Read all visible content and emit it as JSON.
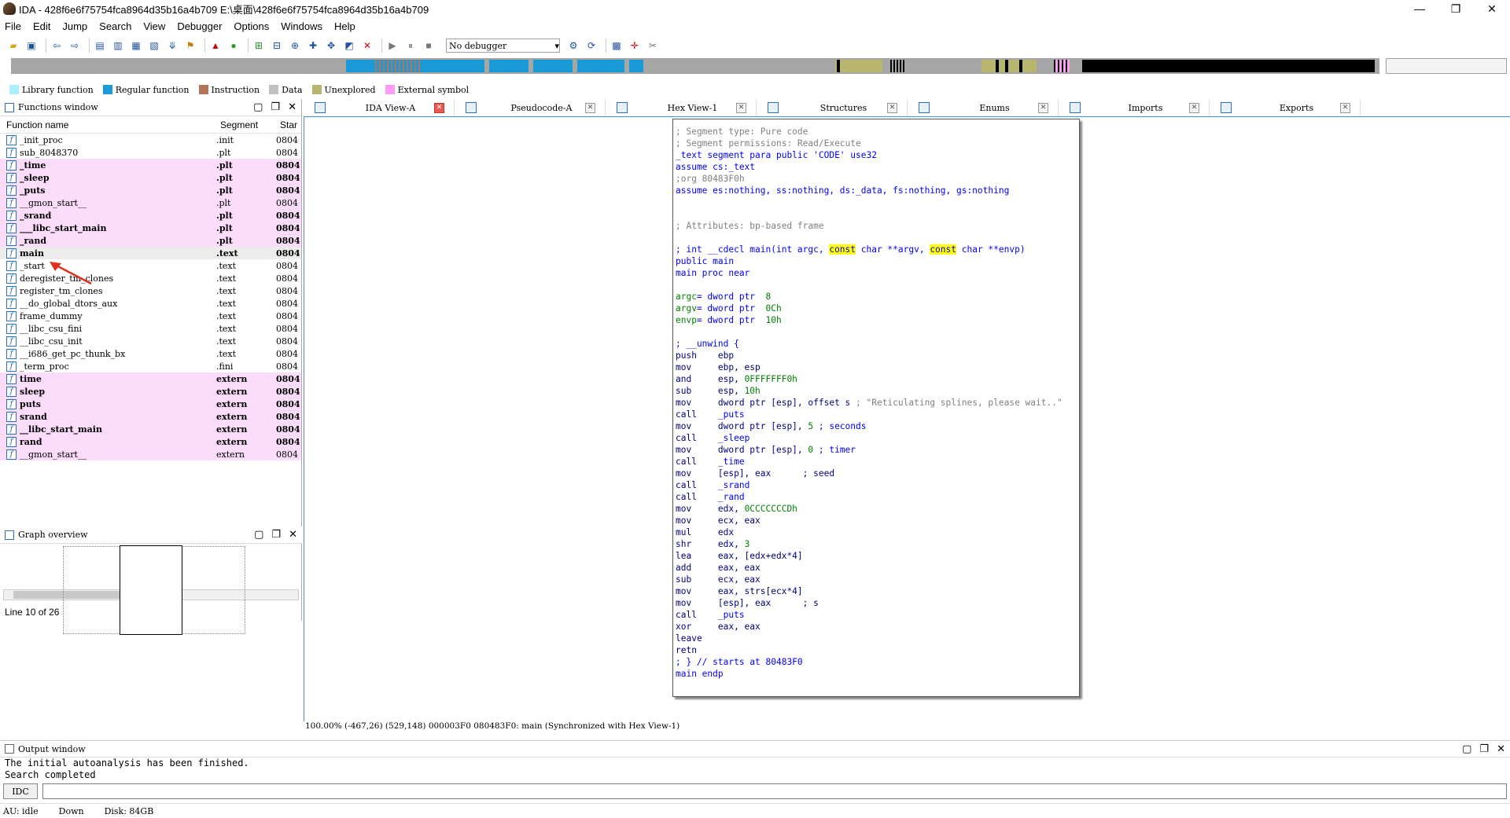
{
  "window": {
    "title": "IDA - 428f6e6f75754fca8964d35b16a4b709 E:\\桌面\\428f6e6f75754fca8964d35b16a4b709"
  },
  "menu": [
    "File",
    "Edit",
    "Jump",
    "Search",
    "View",
    "Debugger",
    "Options",
    "Windows",
    "Help"
  ],
  "toolbar": {
    "debugger": "No debugger"
  },
  "legend": [
    {
      "label": "Library function",
      "color": "#aeefff"
    },
    {
      "label": "Regular function",
      "color": "#1a9ad6"
    },
    {
      "label": "Instruction",
      "color": "#b5735a"
    },
    {
      "label": "Data",
      "color": "#c0c0c0"
    },
    {
      "label": "Unexplored",
      "color": "#b8b56e"
    },
    {
      "label": "External symbol",
      "color": "#ff9cf4"
    }
  ],
  "functions": {
    "title": "Functions window",
    "columns": [
      "Function name",
      "Segment",
      "Star"
    ],
    "rows": [
      {
        "name": "_init_proc",
        "segment": ".init",
        "start": "0804",
        "lib": false,
        "bold": false
      },
      {
        "name": "sub_8048370",
        "segment": ".plt",
        "start": "0804",
        "lib": false,
        "bold": false
      },
      {
        "name": "_time",
        "segment": ".plt",
        "start": "0804",
        "lib": true,
        "bold": true
      },
      {
        "name": "_sleep",
        "segment": ".plt",
        "start": "0804",
        "lib": true,
        "bold": true
      },
      {
        "name": "_puts",
        "segment": ".plt",
        "start": "0804",
        "lib": true,
        "bold": true
      },
      {
        "name": "__gmon_start__",
        "segment": ".plt",
        "start": "0804",
        "lib": true,
        "bold": false
      },
      {
        "name": "_srand",
        "segment": ".plt",
        "start": "0804",
        "lib": true,
        "bold": true
      },
      {
        "name": "___libc_start_main",
        "segment": ".plt",
        "start": "0804",
        "lib": true,
        "bold": true
      },
      {
        "name": "_rand",
        "segment": ".plt",
        "start": "0804",
        "lib": true,
        "bold": true
      },
      {
        "name": "main",
        "segment": ".text",
        "start": "0804",
        "lib": false,
        "bold": true
      },
      {
        "name": "_start",
        "segment": ".text",
        "start": "0804",
        "lib": false,
        "bold": false
      },
      {
        "name": "deregister_tm_clones",
        "segment": ".text",
        "start": "0804",
        "lib": false,
        "bold": false
      },
      {
        "name": "register_tm_clones",
        "segment": ".text",
        "start": "0804",
        "lib": false,
        "bold": false
      },
      {
        "name": "__do_global_dtors_aux",
        "segment": ".text",
        "start": "0804",
        "lib": false,
        "bold": false
      },
      {
        "name": "frame_dummy",
        "segment": ".text",
        "start": "0804",
        "lib": false,
        "bold": false
      },
      {
        "name": "__libc_csu_fini",
        "segment": ".text",
        "start": "0804",
        "lib": false,
        "bold": false
      },
      {
        "name": "__libc_csu_init",
        "segment": ".text",
        "start": "0804",
        "lib": false,
        "bold": false
      },
      {
        "name": "__i686_get_pc_thunk_bx",
        "segment": ".text",
        "start": "0804",
        "lib": false,
        "bold": false
      },
      {
        "name": "_term_proc",
        "segment": ".fini",
        "start": "0804",
        "lib": false,
        "bold": false
      },
      {
        "name": "time",
        "segment": "extern",
        "start": "0804",
        "lib": true,
        "bold": true
      },
      {
        "name": "sleep",
        "segment": "extern",
        "start": "0804",
        "lib": true,
        "bold": true
      },
      {
        "name": "puts",
        "segment": "extern",
        "start": "0804",
        "lib": true,
        "bold": true
      },
      {
        "name": "srand",
        "segment": "extern",
        "start": "0804",
        "lib": true,
        "bold": true
      },
      {
        "name": "__libc_start_main",
        "segment": "extern",
        "start": "0804",
        "lib": true,
        "bold": true
      },
      {
        "name": "rand",
        "segment": "extern",
        "start": "0804",
        "lib": true,
        "bold": true
      },
      {
        "name": "__gmon_start__",
        "segment": "extern",
        "start": "0804",
        "lib": true,
        "bold": false
      }
    ],
    "line_info": "Line 10 of 26"
  },
  "graph_overview": {
    "title": "Graph overview"
  },
  "tabs": [
    {
      "label": "IDA View-A",
      "active": true
    },
    {
      "label": "Pseudocode-A",
      "active": false
    },
    {
      "label": "Hex View-1",
      "active": false
    },
    {
      "label": "Structures",
      "active": false
    },
    {
      "label": "Enums",
      "active": false
    },
    {
      "label": "Imports",
      "active": false
    },
    {
      "label": "Exports",
      "active": false
    }
  ],
  "code": [
    [
      {
        "t": "; Segment type: Pure code",
        "c": "c-gray"
      }
    ],
    [
      {
        "t": "; Segment permissions: Read/Execute",
        "c": "c-gray"
      }
    ],
    [
      {
        "t": "_text segment para public 'CODE' use32",
        "c": "c-blue"
      }
    ],
    [
      {
        "t": "assume cs:_text",
        "c": "c-blue"
      }
    ],
    [
      {
        "t": ";org 80483F0h",
        "c": "c-gray"
      }
    ],
    [
      {
        "t": "assume es:nothing, ss:nothing, ds:_data, fs:nothing, gs:nothing",
        "c": "c-blue"
      }
    ],
    [],
    [],
    [
      {
        "t": "; Attributes: bp-based frame",
        "c": "c-gray"
      }
    ],
    [],
    [
      {
        "t": "; int __cdecl main(int argc, ",
        "c": "c-blue"
      },
      {
        "t": "const",
        "c": "c-blue hl"
      },
      {
        "t": " char **argv, ",
        "c": "c-blue"
      },
      {
        "t": "const",
        "c": "c-blue hl"
      },
      {
        "t": " char **envp)",
        "c": "c-blue"
      }
    ],
    [
      {
        "t": "public main",
        "c": "c-blue"
      }
    ],
    [
      {
        "t": "main proc near",
        "c": "c-blue"
      }
    ],
    [],
    [
      {
        "t": "argc",
        "c": "c-green"
      },
      {
        "t": "= dword ptr  ",
        "c": "c-blue"
      },
      {
        "t": "8",
        "c": "c-green"
      }
    ],
    [
      {
        "t": "argv",
        "c": "c-green"
      },
      {
        "t": "= dword ptr  ",
        "c": "c-blue"
      },
      {
        "t": "0Ch",
        "c": "c-green"
      }
    ],
    [
      {
        "t": "envp",
        "c": "c-green"
      },
      {
        "t": "= dword ptr  ",
        "c": "c-blue"
      },
      {
        "t": "10h",
        "c": "c-green"
      }
    ],
    [],
    [
      {
        "t": "; __unwind {",
        "c": "c-blue"
      }
    ],
    [
      {
        "t": "push    ebp",
        "c": "c-navy"
      }
    ],
    [
      {
        "t": "mov     ebp, esp",
        "c": "c-navy"
      }
    ],
    [
      {
        "t": "and     esp, ",
        "c": "c-navy"
      },
      {
        "t": "0FFFFFFF0h",
        "c": "c-green"
      }
    ],
    [
      {
        "t": "sub     esp, ",
        "c": "c-navy"
      },
      {
        "t": "10h",
        "c": "c-green"
      }
    ],
    [
      {
        "t": "mov     dword ptr [esp], offset s ",
        "c": "c-navy"
      },
      {
        "t": "; \"Reticulating splines, please wait..\"",
        "c": "c-gray"
      }
    ],
    [
      {
        "t": "call    ",
        "c": "c-navy"
      },
      {
        "t": "_puts",
        "c": "c-blue"
      }
    ],
    [
      {
        "t": "mov     dword ptr [esp], ",
        "c": "c-navy"
      },
      {
        "t": "5",
        "c": "c-green"
      },
      {
        "t": " ; seconds",
        "c": "c-blue"
      }
    ],
    [
      {
        "t": "call    ",
        "c": "c-navy"
      },
      {
        "t": "_sleep",
        "c": "c-blue"
      }
    ],
    [
      {
        "t": "mov     dword ptr [esp], ",
        "c": "c-navy"
      },
      {
        "t": "0",
        "c": "c-green"
      },
      {
        "t": " ; timer",
        "c": "c-blue"
      }
    ],
    [
      {
        "t": "call    ",
        "c": "c-navy"
      },
      {
        "t": "_time",
        "c": "c-blue"
      }
    ],
    [
      {
        "t": "mov     [esp], eax      ; seed",
        "c": "c-navy"
      }
    ],
    [
      {
        "t": "call    ",
        "c": "c-navy"
      },
      {
        "t": "_srand",
        "c": "c-blue"
      }
    ],
    [
      {
        "t": "call    ",
        "c": "c-navy"
      },
      {
        "t": "_rand",
        "c": "c-blue"
      }
    ],
    [
      {
        "t": "mov     edx, ",
        "c": "c-navy"
      },
      {
        "t": "0CCCCCCCDh",
        "c": "c-green"
      }
    ],
    [
      {
        "t": "mov     ecx, eax",
        "c": "c-navy"
      }
    ],
    [
      {
        "t": "mul     edx",
        "c": "c-navy"
      }
    ],
    [
      {
        "t": "shr     edx, ",
        "c": "c-navy"
      },
      {
        "t": "3",
        "c": "c-green"
      }
    ],
    [
      {
        "t": "lea     eax, [edx+edx*4]",
        "c": "c-navy"
      }
    ],
    [
      {
        "t": "add     eax, eax",
        "c": "c-navy"
      }
    ],
    [
      {
        "t": "sub     ecx, eax",
        "c": "c-navy"
      }
    ],
    [
      {
        "t": "mov     eax, strs[ecx*4]",
        "c": "c-navy"
      }
    ],
    [
      {
        "t": "mov     [esp], eax      ; s",
        "c": "c-navy"
      }
    ],
    [
      {
        "t": "call    ",
        "c": "c-navy"
      },
      {
        "t": "_puts",
        "c": "c-blue"
      }
    ],
    [
      {
        "t": "xor     eax, eax",
        "c": "c-navy"
      }
    ],
    [
      {
        "t": "leave",
        "c": "c-navy"
      }
    ],
    [
      {
        "t": "retn",
        "c": "c-navy"
      }
    ],
    [
      {
        "t": "; } // starts at 80483F0",
        "c": "c-blue"
      }
    ],
    [
      {
        "t": "main endp",
        "c": "c-blue"
      }
    ]
  ],
  "view_status": "100.00% (-467,26) (529,148) 000003F0 080483F0: main (Synchronized with Hex View-1)",
  "output": {
    "title": "Output window",
    "lines": [
      "The initial autoanalysis has been finished.",
      "Search completed"
    ],
    "idc_label": "IDC"
  },
  "status": {
    "au": "AU:  idle",
    "dir": "Down",
    "disk": "Disk: 84GB"
  }
}
